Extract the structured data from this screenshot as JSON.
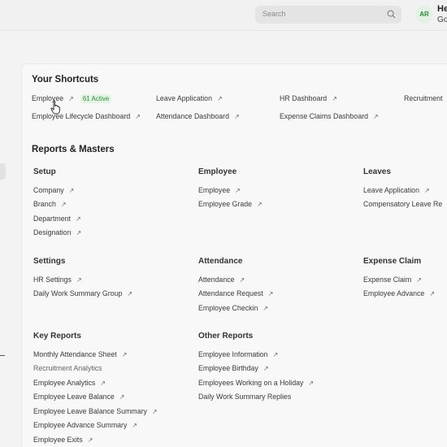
{
  "topbar": {
    "search_placeholder": "Search",
    "avatar_initials": "AR",
    "user_name": "He",
    "user_sub": "Go"
  },
  "shortcuts": {
    "title": "Your Shortcuts",
    "items": [
      {
        "label": "Employee",
        "badge": "61 Active"
      },
      {
        "label": "Leave Application"
      },
      {
        "label": "HR Dashboard"
      },
      {
        "label": "Recruitment"
      },
      {
        "label": "Employee Lifecycle Dashboard"
      },
      {
        "label": "Attendance Dashboard"
      },
      {
        "label": "Expense Claims Dashboard"
      }
    ]
  },
  "reports": {
    "title": "Reports & Masters",
    "groups": {
      "setup": {
        "title": "Setup",
        "links": [
          "Company",
          "Branch",
          "Department",
          "Designation"
        ]
      },
      "employee": {
        "title": "Employee",
        "links": [
          "Employee",
          "Employee Grade"
        ]
      },
      "leaves": {
        "title": "Leaves",
        "links": [
          "Leave Application",
          "Compensatory Leave Re"
        ]
      },
      "settings": {
        "title": "Settings",
        "links": [
          "HR Settings",
          "Daily Work Summary Group"
        ]
      },
      "attendance": {
        "title": "Attendance",
        "links": [
          "Attendance",
          "Attendance Request",
          "Employee Checkin"
        ]
      },
      "expense": {
        "title": "Expense Claim",
        "links": [
          "Expense Claim",
          "Employee Advance"
        ]
      },
      "key_reports": {
        "title": "Key Reports",
        "links": [
          "Monthly Attendance Sheet",
          "Recruitment Analytics",
          "Employee Analytics",
          "Employee Leave Balance",
          "Employee Leave Balance Summary",
          "Employee Advance Summary",
          "Employee Exits"
        ]
      },
      "other_reports": {
        "title": "Other Reports",
        "links": [
          "Employee Information",
          "Employee Birthday",
          "Employees Working on a Holiday",
          "Daily Work Summary Replies"
        ]
      }
    }
  },
  "arrow_glyph": "↗"
}
